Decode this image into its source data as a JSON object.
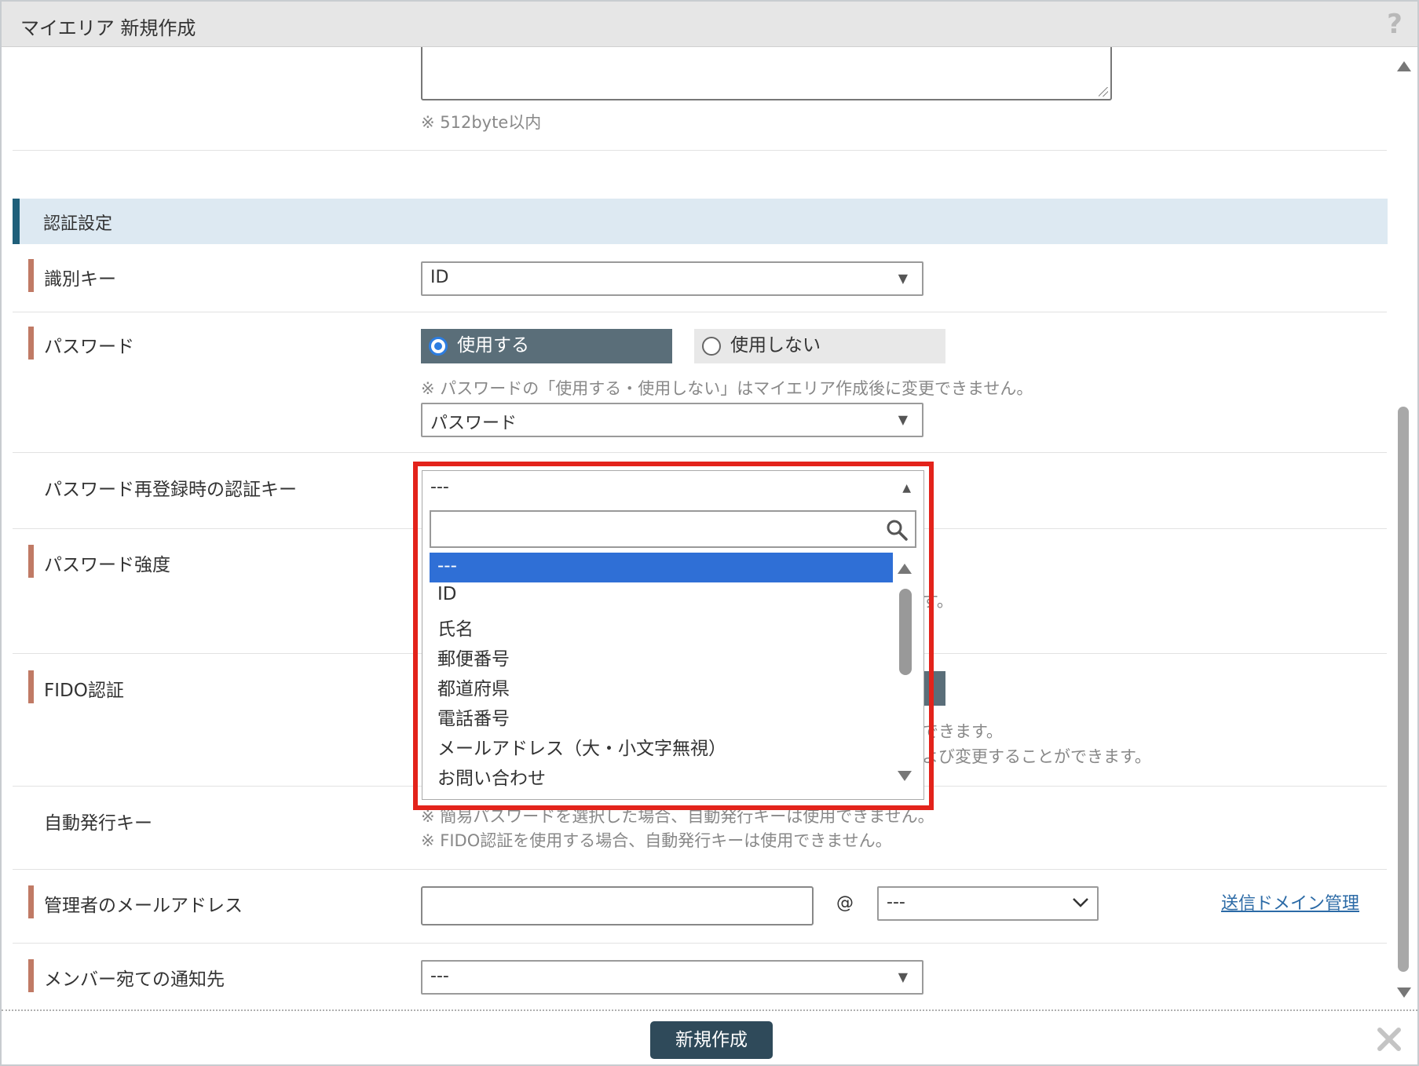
{
  "window": {
    "title": "マイエリア 新規作成",
    "help_icon": "?"
  },
  "top_note": "※ 512byte以内",
  "section": {
    "title": "認証設定"
  },
  "rows": {
    "identifier_key": {
      "label": "識別キー",
      "value": "ID"
    },
    "password": {
      "label": "パスワード",
      "option_use": "使用する",
      "option_not_use": "使用しない",
      "note": "※ パスワードの「使用する・使用しない」はマイエリア作成後に変更できません。",
      "type_value": "パスワード"
    },
    "reregister_key": {
      "label": "パスワード再登録時の認証キー",
      "value": "---"
    },
    "password_strength": {
      "label": "パスワード強度",
      "note_fragment": "す。"
    },
    "fido": {
      "label": "FIDO認証",
      "note1_fragment": "できます。",
      "note2_fragment": "よび変更することができます。"
    },
    "auto_key": {
      "label": "自動発行キー",
      "note1": "※ 簡易パスワードを選択した場合、自動発行キーは使用できません。",
      "note2": "※ FIDO認証を使用する場合、自動発行キーは使用できません。"
    },
    "admin_email": {
      "label": "管理者のメールアドレス",
      "local_value": "",
      "at": "@",
      "domain_value": "---",
      "link": "送信ドメイン管理"
    },
    "member_notify": {
      "label": "メンバー宛ての通知先",
      "value": "---"
    }
  },
  "dropdown": {
    "current": "---",
    "search_value": "",
    "options": [
      "---",
      "ID",
      "氏名",
      "郵便番号",
      "都道府県",
      "電話番号",
      "メールアドレス（大・小文字無視）",
      "お問い合わせ"
    ],
    "selected_index": 0
  },
  "footer": {
    "create_label": "新規作成"
  },
  "icons": {
    "search": "search-icon",
    "close": "close-icon",
    "help": "help-icon"
  },
  "colors": {
    "highlight_frame": "#e3231b",
    "selected_option": "#2f6fd6",
    "section_accent": "#1f5f7a",
    "required_bar": "#c07a65",
    "primary_button": "#2f4a5a"
  }
}
